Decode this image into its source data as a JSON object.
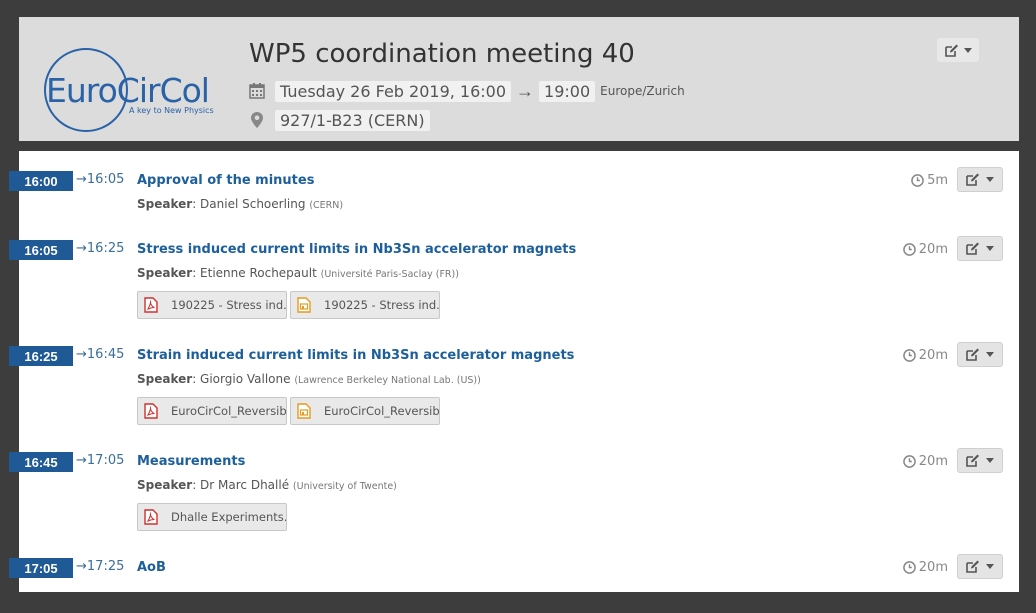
{
  "event": {
    "title": "WP5 coordination meeting 40",
    "date_start": "Tuesday 26 Feb 2019, 16:00",
    "date_arrow": "→",
    "date_end": "19:00",
    "timezone": "Europe/Zurich",
    "location": "927/1-B23 (CERN)",
    "logo": {
      "name": "EuroCirCol",
      "tagline": "A key to New Physics",
      "color": "#2a62a8"
    }
  },
  "icons": {
    "calendar": "calendar-icon",
    "location": "map-pin-icon",
    "clock": "clock-icon",
    "edit": "edit-icon",
    "caret": "caret-down-icon",
    "pdf": "pdf-file-icon",
    "slides": "presentation-file-icon"
  },
  "colors": {
    "badge": "#1f5a96",
    "title_link": "#1d5f9b",
    "pdf": "#d0312d",
    "slides": "#e69a1f"
  },
  "arrow": "→",
  "speaker_label": "Speaker",
  "items": [
    {
      "start": "16:00",
      "end": "16:05",
      "title": "Approval of the minutes",
      "speaker": "Daniel Schoerling",
      "affiliation": "(CERN)",
      "duration": "5m",
      "files": []
    },
    {
      "start": "16:05",
      "end": "16:25",
      "title": "Stress induced current limits in Nb3Sn accelerator magnets",
      "speaker": "Etienne Rochepault",
      "affiliation": "(Université Paris-Saclay (FR))",
      "duration": "20m",
      "files": [
        {
          "type": "pdf",
          "name": "190225 - Stress ind..."
        },
        {
          "type": "slides",
          "name": "190225 - Stress ind..."
        }
      ]
    },
    {
      "start": "16:25",
      "end": "16:45",
      "title": "Strain induced current limits in Nb3Sn accelerator magnets",
      "speaker": "Giorgio Vallone",
      "affiliation": "(Lawrence Berkeley National Lab. (US))",
      "duration": "20m",
      "files": [
        {
          "type": "pdf",
          "name": "EuroCirCol_Reversib..."
        },
        {
          "type": "slides",
          "name": "EuroCirCol_Reversib..."
        }
      ]
    },
    {
      "start": "16:45",
      "end": "17:05",
      "title": "Measurements",
      "speaker": "Dr Marc Dhallé",
      "affiliation": "(University of Twente)",
      "duration": "20m",
      "files": [
        {
          "type": "pdf",
          "name": "Dhalle Experiments...."
        }
      ]
    },
    {
      "start": "17:05",
      "end": "17:25",
      "title": "AoB",
      "speaker": "",
      "affiliation": "",
      "duration": "20m",
      "files": []
    }
  ]
}
